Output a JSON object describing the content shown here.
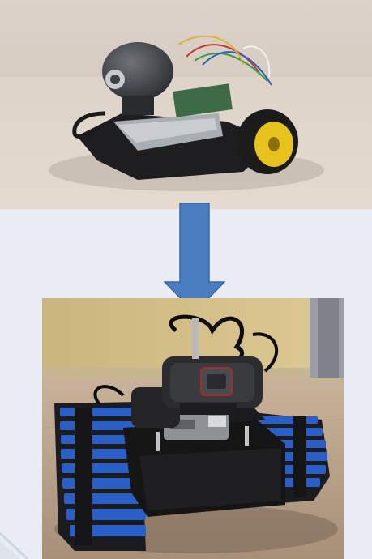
{
  "figure": {
    "top_photo": {
      "subject": "wheeled-robot-prototype",
      "background_color": "#d9cfc6",
      "table_color": "#e4d9cf"
    },
    "arrow": {
      "direction": "down",
      "fill_color": "#4a7cc0",
      "stroke_color": "#3a67a8"
    },
    "bottom_photo": {
      "subject": "tracked-robot-final",
      "wall_color": "#d4c08a",
      "floor_color": "#b59d85",
      "track_color": "#2a5fc8"
    },
    "page_background": "#e9edf3"
  }
}
